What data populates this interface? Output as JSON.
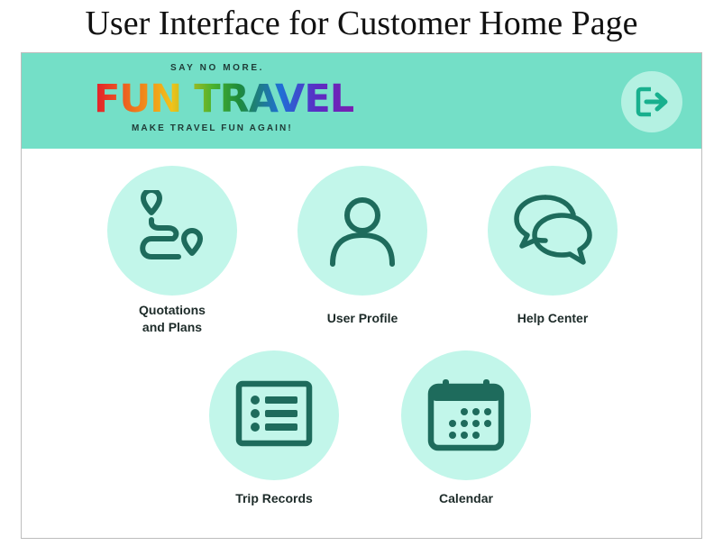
{
  "caption": "User Interface for Customer Home Page",
  "header": {
    "tagline": "SAY NO MORE.",
    "logo_text": "FUN TRAVEL",
    "subtagline": "MAKE TRAVEL FUN AGAIN!",
    "logout_icon": "logout-icon"
  },
  "tiles": [
    {
      "label_line1": "Quotations",
      "label_line2": "and Plans",
      "icon": "route-icon"
    },
    {
      "label": "User Profile",
      "icon": "user-icon"
    },
    {
      "label": "Help Center",
      "icon": "chat-icon"
    },
    {
      "label": "Trip Records",
      "icon": "list-icon"
    },
    {
      "label": "Calendar",
      "icon": "calendar-icon"
    }
  ],
  "colors": {
    "header_bg": "#74dfc7",
    "circle_bg": "#c2f6ea",
    "icon": "#1e6b5c",
    "logout_icon": "#18b08e"
  }
}
